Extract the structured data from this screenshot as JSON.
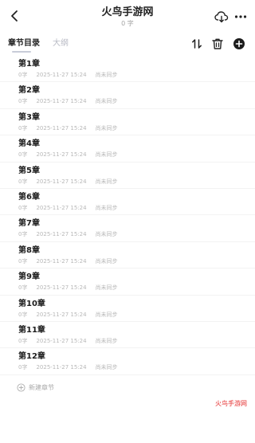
{
  "header": {
    "title": "火鸟手游网",
    "subtitle": "0 字"
  },
  "tabs": {
    "active_label": "章节目录",
    "inactive_label": "大纲"
  },
  "chapters": [
    {
      "title": "第1章",
      "words": "0字",
      "date": "2025-11-27 15:24",
      "status": "尚未同步"
    },
    {
      "title": "第2章",
      "words": "0字",
      "date": "2025-11-27 15:24",
      "status": "尚未同步"
    },
    {
      "title": "第3章",
      "words": "0字",
      "date": "2025-11-27 15:24",
      "status": "尚未同步"
    },
    {
      "title": "第4章",
      "words": "0字",
      "date": "2025-11-27 15:24",
      "status": "尚未同步"
    },
    {
      "title": "第5章",
      "words": "0字",
      "date": "2025-11-27 15:24",
      "status": "尚未同步"
    },
    {
      "title": "第6章",
      "words": "0字",
      "date": "2025-11-27 15:24",
      "status": "尚未同步"
    },
    {
      "title": "第7章",
      "words": "0字",
      "date": "2025-11-27 15:24",
      "status": "尚未同步"
    },
    {
      "title": "第8章",
      "words": "0字",
      "date": "2025-11-27 15:24",
      "status": "尚未同步"
    },
    {
      "title": "第9章",
      "words": "0字",
      "date": "2025-11-27 15:24",
      "status": "尚未同步"
    },
    {
      "title": "第10章",
      "words": "0字",
      "date": "2025-11-27 15:24",
      "status": "尚未同步"
    },
    {
      "title": "第11章",
      "words": "0字",
      "date": "2025-11-27 15:24",
      "status": "尚未同步"
    },
    {
      "title": "第12章",
      "words": "0字",
      "date": "2025-11-27 15:24",
      "status": "尚未同步"
    }
  ],
  "new_chapter_label": "新建章节",
  "watermark": "火鸟手游网",
  "icons": {
    "back": "chevron-left-icon",
    "cloud": "cloud-sync-icon",
    "more": "more-dots-icon",
    "sort": "sort-arrows-icon",
    "trash": "trash-icon",
    "add": "add-circle-icon",
    "new_chapter": "plus-circle-icon"
  },
  "colors": {
    "watermark": "#e53030",
    "meta_text": "#b8b8b8",
    "inactive_tab": "#b8bac4"
  }
}
